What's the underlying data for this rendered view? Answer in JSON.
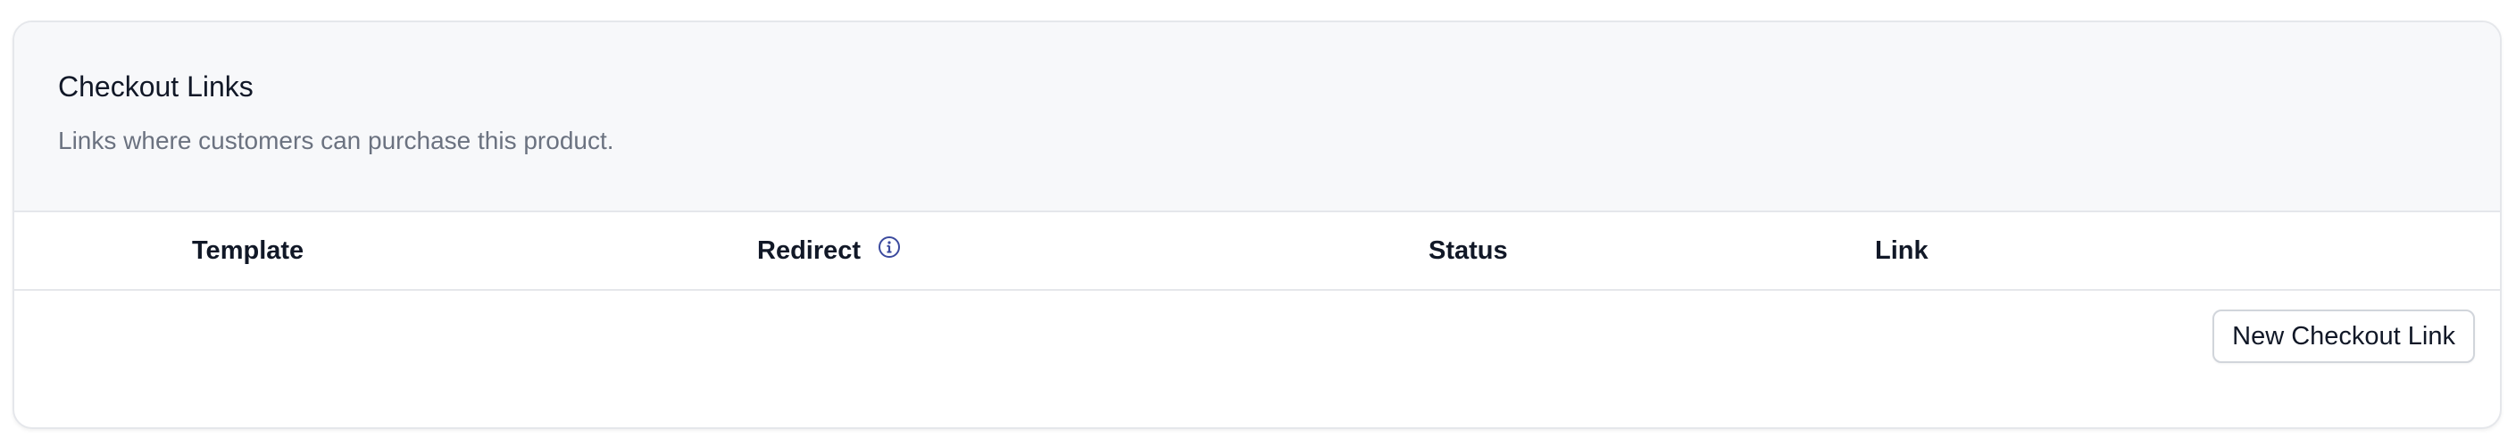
{
  "card": {
    "title": "Checkout Links",
    "subtitle": "Links where customers can purchase this product."
  },
  "table": {
    "columns": [
      {
        "label": "Template"
      },
      {
        "label": "Redirect",
        "icon": "info-icon"
      },
      {
        "label": "Status"
      },
      {
        "label": "Link"
      }
    ],
    "rows": []
  },
  "actions": {
    "new_checkout_link_label": "New Checkout Link"
  },
  "colors": {
    "header_bg": "#f7f8fa",
    "border": "#e5e7eb",
    "subtitle_text": "#6b7280",
    "info_icon": "#3b4a9e"
  }
}
